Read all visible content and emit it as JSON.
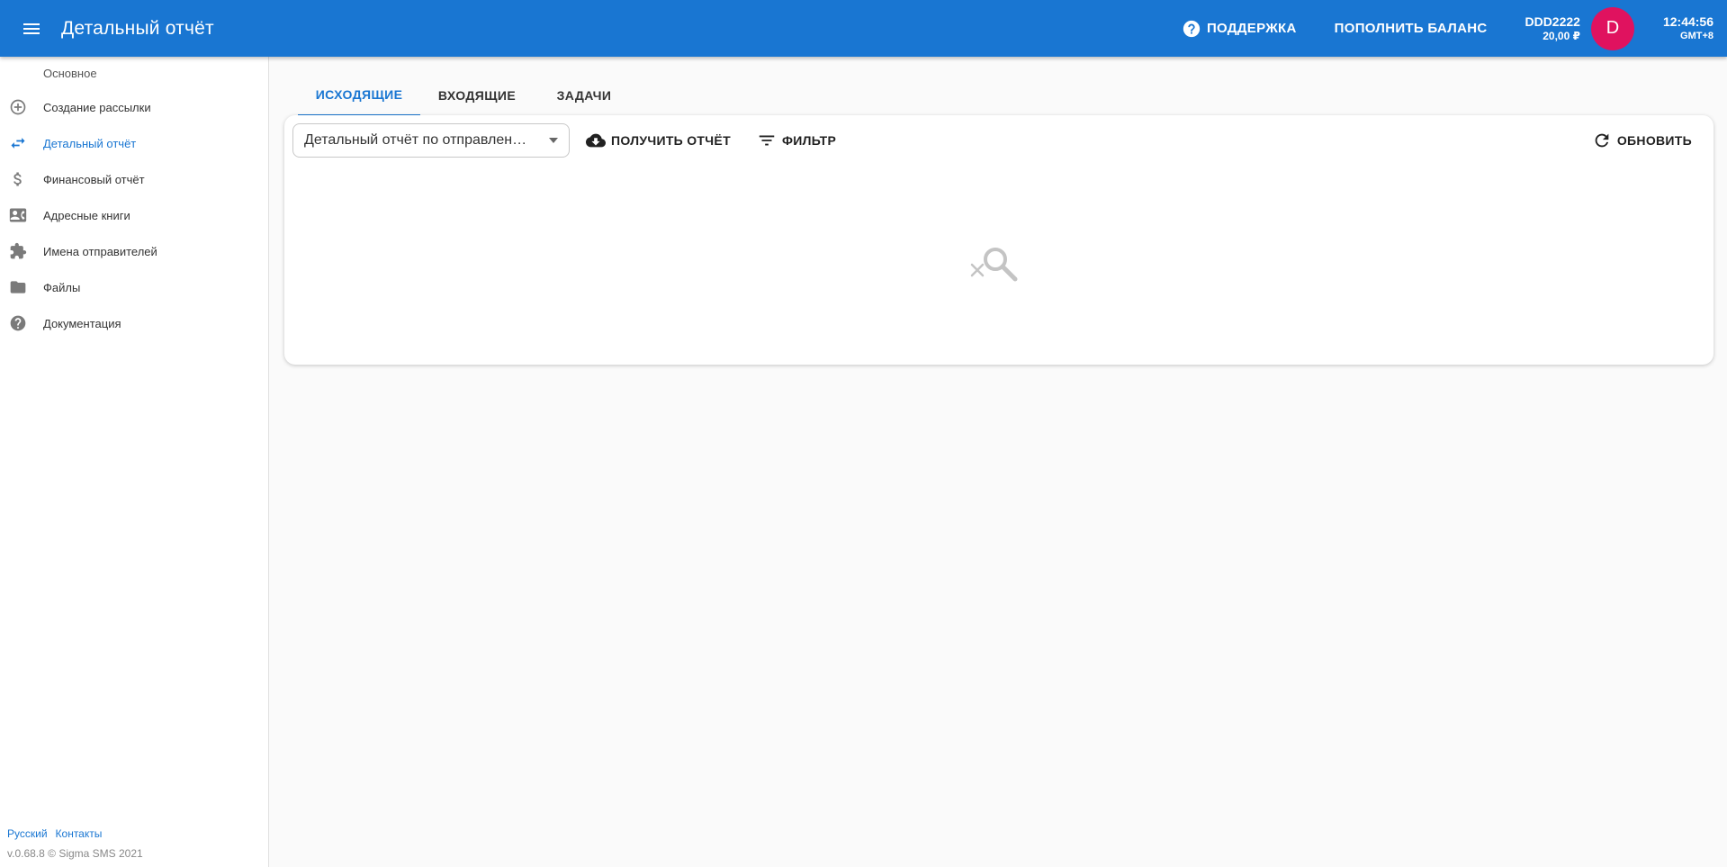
{
  "header": {
    "title": "Детальный отчёт",
    "support_label": "ПОДДЕРЖКА",
    "topup_label": "ПОПОЛНИТЬ БАЛАНС",
    "account_name": "DDD2222",
    "account_balance": "20,00 ₽",
    "avatar_letter": "D",
    "time": "12:44:56",
    "timezone": "GMT+8"
  },
  "sidebar": {
    "section_title": "Основное",
    "items": [
      {
        "label": "Создание рассылки",
        "icon": "add-circle-icon"
      },
      {
        "label": "Детальный отчёт",
        "icon": "swap-arrows-icon",
        "active": true
      },
      {
        "label": "Финансовый отчёт",
        "icon": "dollar-icon"
      },
      {
        "label": "Адресные книги",
        "icon": "contact-card-icon"
      },
      {
        "label": "Имена отправителей",
        "icon": "puzzle-icon"
      },
      {
        "label": "Файлы",
        "icon": "folder-icon"
      },
      {
        "label": "Документация",
        "icon": "help-icon"
      }
    ],
    "footer": {
      "language_link": "Русский",
      "contacts_link": "Контакты",
      "version": "v.0.68.8 © Sigma SMS 2021"
    }
  },
  "main": {
    "tabs": [
      {
        "label": "ИСХОДЯЩИЕ",
        "active": true
      },
      {
        "label": "ВХОДЯЩИЕ"
      },
      {
        "label": "ЗАДАЧИ"
      }
    ],
    "report_select_value": "Детальный отчёт по отправлениям",
    "get_report_label": "ПОЛУЧИТЬ ОТЧЁТ",
    "filter_label": "ФИЛЬТР",
    "refresh_label": "ОБНОВИТЬ",
    "empty_state_icon": "search-off-icon"
  },
  "colors": {
    "primary": "#1976d2",
    "avatar": "#e0125f"
  }
}
